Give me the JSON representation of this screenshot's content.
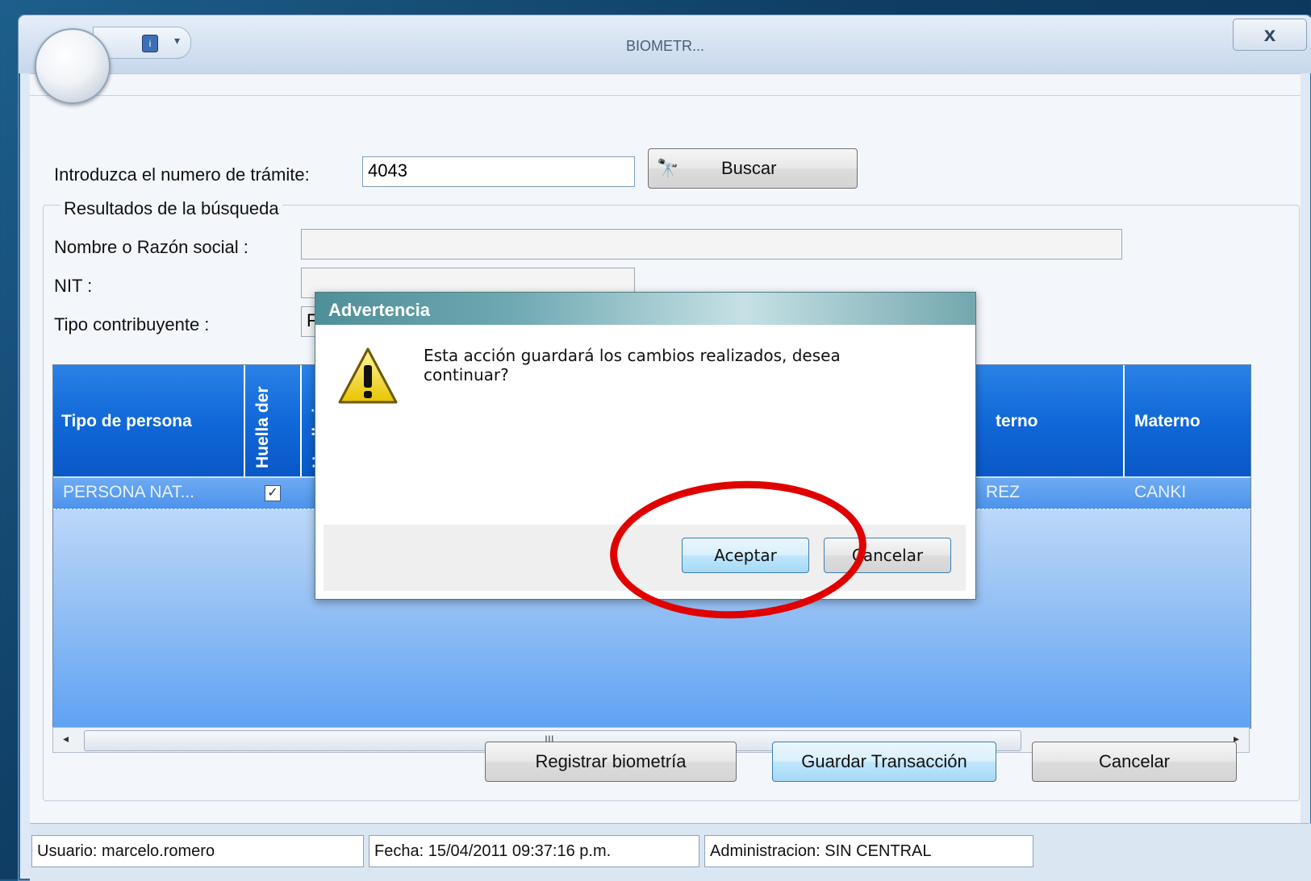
{
  "window": {
    "title": "BIOMETR...",
    "close_label": "x"
  },
  "form": {
    "tramite_label": "Introduzca el numero de trámite:",
    "tramite_value": "4043",
    "search_label": "Buscar",
    "results_group_label": "Resultados de la búsqueda",
    "nombre_label": "Nombre o Razón social :",
    "nombre_value": "",
    "nit_label": "NIT :",
    "nit_value": "",
    "tipo_label": "Tipo contribuyente :",
    "tipo_value_partial": "F"
  },
  "grid": {
    "columns": [
      "Tipo de persona",
      "Huella der",
      "Huella izq",
      "Paterno",
      "Materno"
    ],
    "visible_header_fragments": {
      "paterno": "terno",
      "materno": "Materno",
      "huella_izq": "Huella izq"
    },
    "rows": [
      {
        "tipo_persona": "PERSONA NAT...",
        "huella_der": true,
        "huella_izq": true,
        "paterno_fragment": "REZ",
        "materno": "CANKI"
      }
    ],
    "scroll_grip": "III"
  },
  "buttons": {
    "registrar": "Registrar biometría",
    "guardar": "Guardar Transacción",
    "cancelar": "Cancelar"
  },
  "status": {
    "usuario": "Usuario: marcelo.romero",
    "fecha": "Fecha: 15/04/2011 09:37:16 p.m.",
    "administracion": "Administracion: SIN CENTRAL"
  },
  "dialog": {
    "title": "Advertencia",
    "message": "Esta acción guardará los cambios realizados, desea continuar?",
    "accept_label": "Aceptar",
    "cancel_label": "Cancelar",
    "icon": "warning-icon"
  },
  "colors": {
    "grid_header": "#1168d8",
    "highlight_circle": "#e00000",
    "dialog_title": "#4f8f98"
  }
}
